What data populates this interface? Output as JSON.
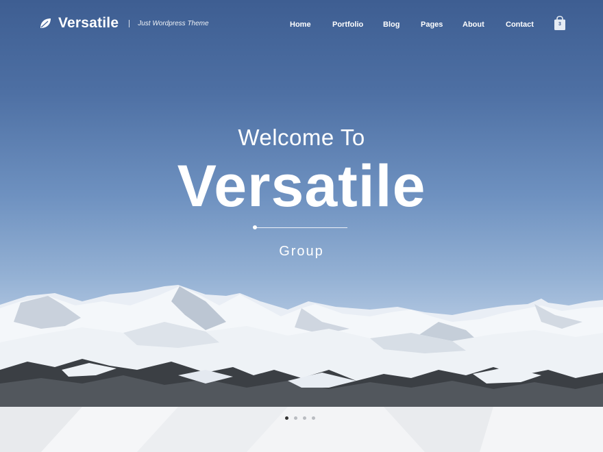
{
  "brand": {
    "name": "Versatile",
    "tagline": "Just Wordpress Theme"
  },
  "nav": {
    "items": [
      {
        "label": "Home"
      },
      {
        "label": "Portfolio"
      },
      {
        "label": "Blog"
      },
      {
        "label": "Pages"
      },
      {
        "label": "About"
      },
      {
        "label": "Contact"
      }
    ]
  },
  "cart": {
    "count": "3"
  },
  "hero": {
    "welcome": "Welcome To",
    "title": "Versatile",
    "subtitle": "Group"
  },
  "slider": {
    "total": 4,
    "active": 1
  },
  "colors": {
    "sky_top": "#3e5e92",
    "sky_bottom": "#c8d6e8",
    "text": "#ffffff",
    "band": "#eef0f2"
  }
}
